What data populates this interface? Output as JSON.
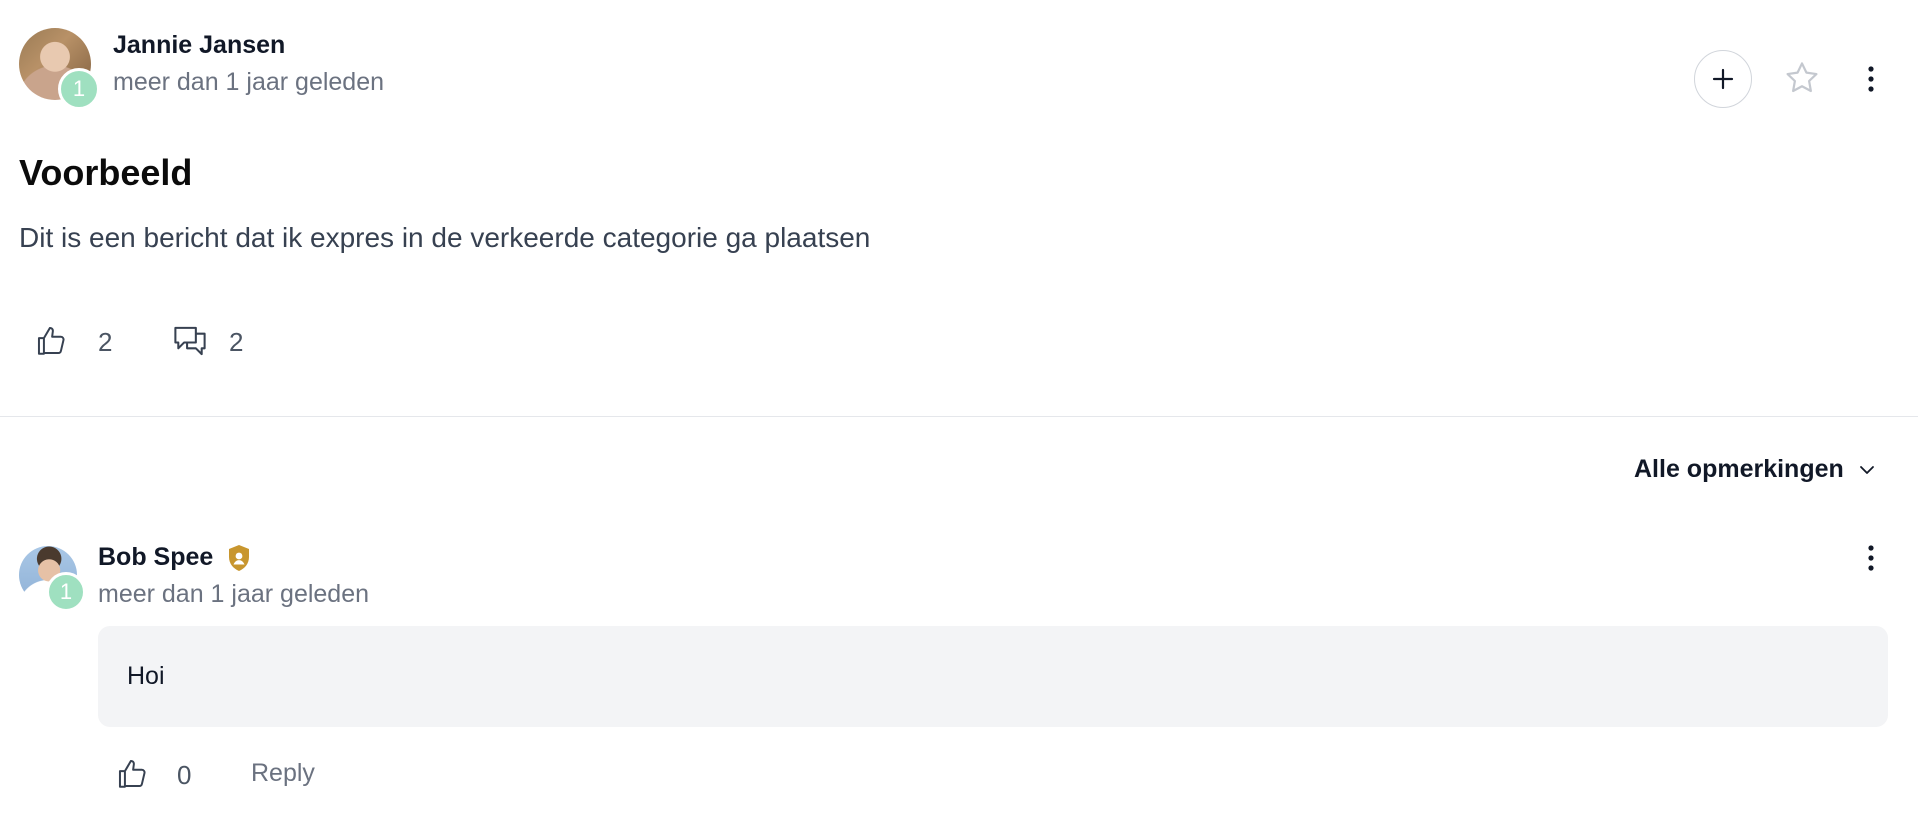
{
  "post": {
    "author": "Jannie Jansen",
    "author_level": "1",
    "timestamp": "meer dan 1 jaar geleden",
    "title": "Voorbeeld",
    "body": "Dit is een bericht dat ik expres in de verkeerde categorie ga plaatsen",
    "like_count": "2",
    "comment_count": "2",
    "icons": {
      "follow": "plus-icon",
      "favorite": "star-icon",
      "menu": "more-vertical-icon",
      "like": "thumbs-up-icon",
      "comments": "comments-icon"
    }
  },
  "comments_section": {
    "sort_label": "Alle opmerkingen",
    "sort_icon": "chevron-down-icon"
  },
  "comments": [
    {
      "author": "Bob Spee",
      "author_level": "1",
      "badge_icon": "moderator-shield-icon",
      "timestamp": "meer dan 1 jaar geleden",
      "text": "Hoi",
      "like_count": "0",
      "reply_label": "Reply"
    }
  ],
  "colors": {
    "level_badge": "#9fe0c0",
    "moderator_badge": "#c8962e",
    "comment_bg": "#f3f4f6",
    "muted_text": "#6b7280"
  }
}
